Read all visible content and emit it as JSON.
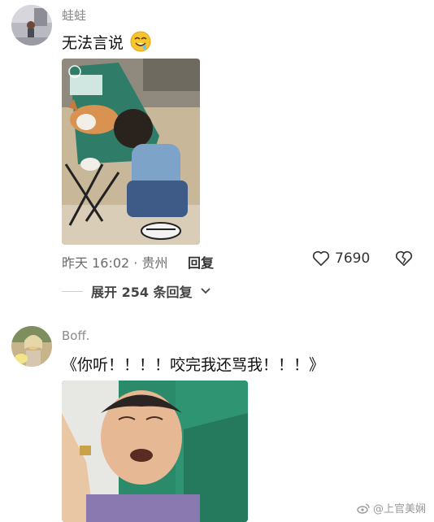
{
  "comment1": {
    "username": "蛙蛙",
    "text": "无法言说",
    "emoji": "smiling-drool-emoji",
    "time_location": "昨天 16:02 · 贵州",
    "reply_label": "回复",
    "like_count": "7690",
    "expand_label": "展开 254 条回复"
  },
  "comment2": {
    "username": "Boff.",
    "text": "《你听！！！！咬完我还骂我！！！》"
  },
  "watermark": {
    "text": "@上官美娴"
  }
}
